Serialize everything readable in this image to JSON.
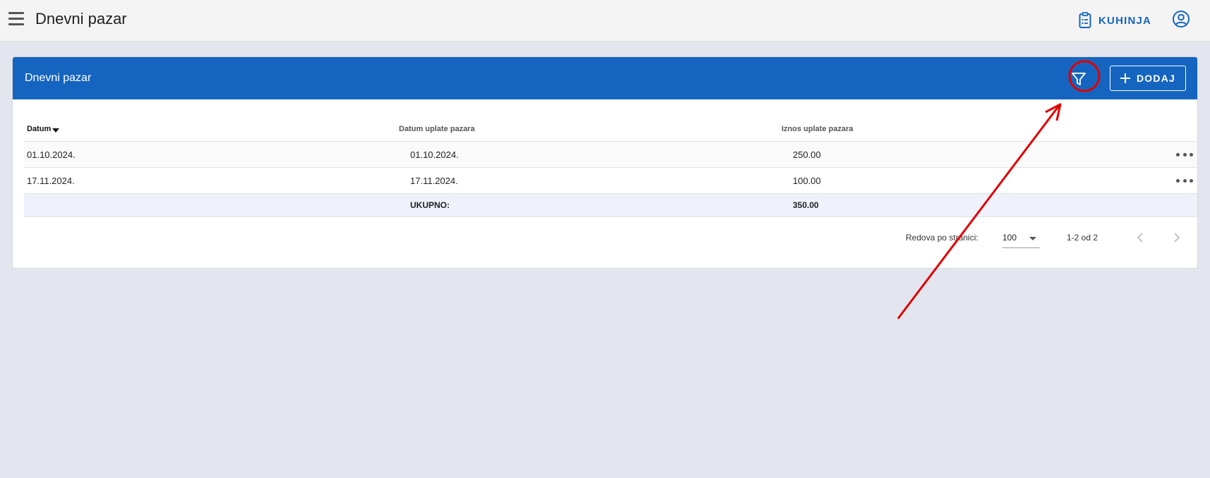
{
  "appbar": {
    "title": "Dnevni pazar",
    "kuhinja_label": "KUHINJA",
    "icons": {
      "menu": "hamburger-icon",
      "kuhinja": "clipboard-list-icon",
      "account": "account-circle-icon"
    }
  },
  "card": {
    "title": "Dnevni pazar",
    "add_label": "DODAJ",
    "icons": {
      "filter": "filter-icon",
      "add": "plus-icon"
    }
  },
  "table": {
    "columns": [
      "Datum",
      "Datum uplate pazara",
      "Iznos uplate pazara"
    ],
    "rows": [
      {
        "datum": "01.10.2024.",
        "datum_uplate": "01.10.2024.",
        "iznos": "250.00"
      },
      {
        "datum": "17.11.2024.",
        "datum_uplate": "17.11.2024.",
        "iznos": "100.00"
      }
    ],
    "total_label": "UKUPNO:",
    "total_value": "350.00"
  },
  "pagination": {
    "rows_per_page_label": "Redova po stranici:",
    "rows_per_page_value": "100",
    "range_text": "1-2 od 2"
  },
  "colors": {
    "primary": "#1565c0",
    "background": "#e3e6ee",
    "annotation": "#e00000"
  }
}
